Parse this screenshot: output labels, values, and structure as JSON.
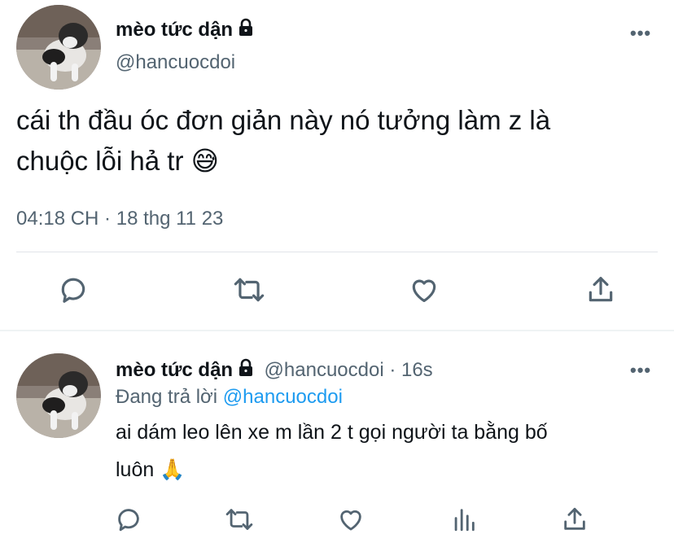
{
  "main_tweet": {
    "display_name": "mèo tức dận",
    "handle": "@hancuocdoi",
    "text_line1": "cái th đầu óc đơn giản này nó tưởng làm z là",
    "text_line2": "chuộc lỗi hả tr",
    "emoji": "😅",
    "timestamp": "04:18 CH · 18 thg 11 23",
    "more_label": "•••"
  },
  "reply_tweet": {
    "display_name": "mèo tức dận",
    "handle_time": "@hancuocdoi · 16s",
    "replying_prefix": "Đang trả lời",
    "replying_to": "@hancuocdoi",
    "text_line1": "ai dám leo lên xe m lần 2 t gọi người ta bằng bố",
    "text_line2": "luôn",
    "emoji": "🙏",
    "more_label": "•••"
  },
  "icons": {
    "reply": "reply-icon",
    "retweet": "retweet-icon",
    "like": "heart-icon",
    "share": "share-icon",
    "views": "views-icon",
    "lock": "lock-icon"
  },
  "colors": {
    "text": "#0f1419",
    "secondary": "#536471",
    "link": "#1d9bf0"
  }
}
